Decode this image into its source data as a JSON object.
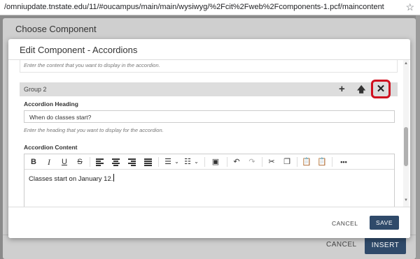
{
  "browser": {
    "url": "/omniupdate.tnstate.edu/11/#oucampus/main/main/wysiwyg/%2Fcit%2Fweb%2Fcomponents-1.pcf/maincontent"
  },
  "outer_dialog": {
    "title": "Choose Component",
    "cancel_label": "CANCEL",
    "insert_label": "INSERT"
  },
  "edit_dialog": {
    "title": "Edit Component - Accordions",
    "previous_content_hint": "Enter the content that you want to display in the accordion.",
    "group": {
      "label": "Group 2",
      "add_icon": "plus-icon",
      "move_up_icon": "arrow-up-icon",
      "remove_icon": "close-icon"
    },
    "heading_field": {
      "label": "Accordion Heading",
      "value": "When do classes start?",
      "hint": "Enter the heading that you want to display for the accordion."
    },
    "content_field": {
      "label": "Accordion Content",
      "text": "Classes start on January 12."
    },
    "toolbar": {
      "bold": "B",
      "italic": "I",
      "underline": "U",
      "strike": "S",
      "more": "•••"
    },
    "cancel_label": "CANCEL",
    "save_label": "SAVE"
  },
  "colors": {
    "primary_button": "#2f4a6a",
    "highlight_box": "#d0101f"
  }
}
